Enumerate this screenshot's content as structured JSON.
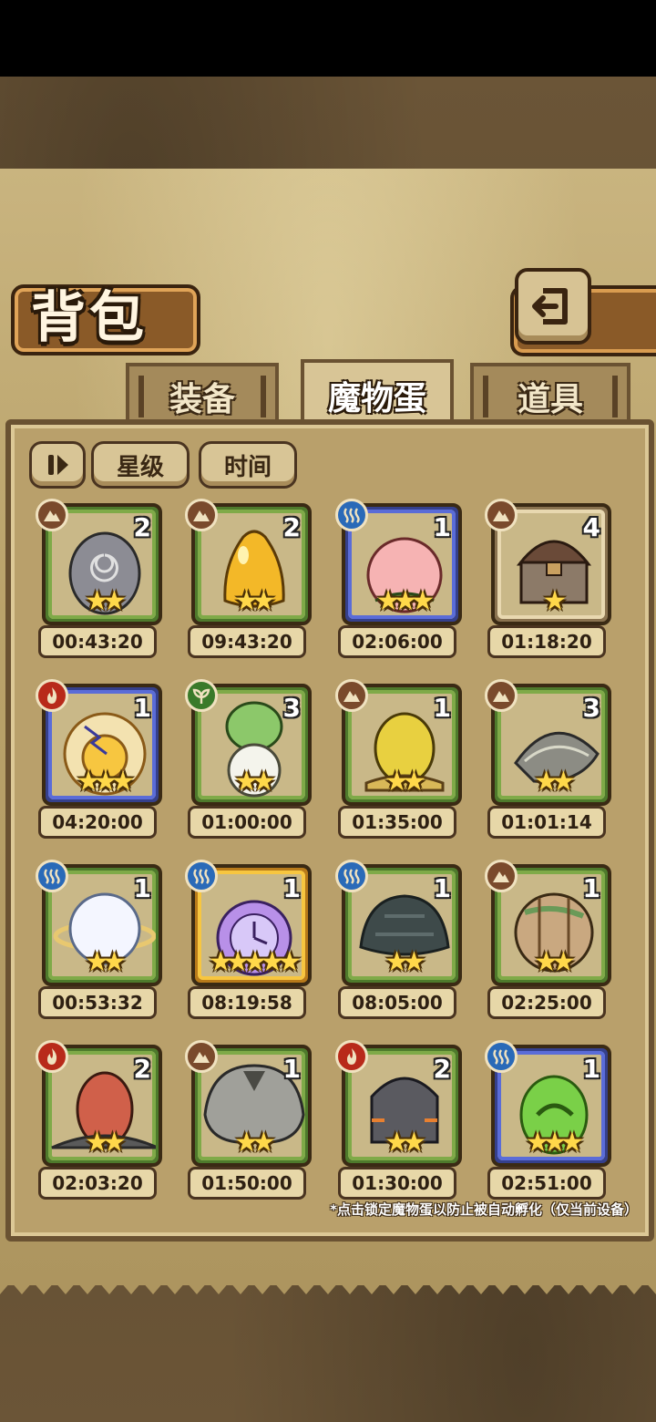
{
  "header": {
    "title": "背包"
  },
  "tabs": [
    {
      "label": "装备",
      "active": false
    },
    {
      "label": "魔物蛋",
      "active": true
    },
    {
      "label": "道具",
      "active": false
    }
  ],
  "toolbar": {
    "sort_star": "星级",
    "sort_time": "时间"
  },
  "eggs": [
    {
      "count": "2",
      "stars": "★★",
      "time": "00:43:20",
      "element": "earth",
      "rarity": "green"
    },
    {
      "count": "2",
      "stars": "★★",
      "time": "09:43:20",
      "element": "earth",
      "rarity": "green"
    },
    {
      "count": "1",
      "stars": "★★★",
      "time": "02:06:00",
      "element": "water",
      "rarity": "blue"
    },
    {
      "count": "4",
      "stars": "★",
      "time": "01:18:20",
      "element": "earth",
      "rarity": "beige"
    },
    {
      "count": "1",
      "stars": "★★★",
      "time": "04:20:00",
      "element": "fire",
      "rarity": "blue"
    },
    {
      "count": "3",
      "stars": "★★",
      "time": "01:00:00",
      "element": "plant",
      "rarity": "green"
    },
    {
      "count": "1",
      "stars": "★★",
      "time": "01:35:00",
      "element": "earth",
      "rarity": "green"
    },
    {
      "count": "3",
      "stars": "★★",
      "time": "01:01:14",
      "element": "earth",
      "rarity": "green"
    },
    {
      "count": "1",
      "stars": "★★",
      "time": "00:53:32",
      "element": "water",
      "rarity": "green"
    },
    {
      "count": "1",
      "stars": "★★★★★",
      "time": "08:19:58",
      "element": "water",
      "rarity": "gold"
    },
    {
      "count": "1",
      "stars": "★★",
      "time": "08:05:00",
      "element": "water",
      "rarity": "green"
    },
    {
      "count": "1",
      "stars": "★★",
      "time": "02:25:00",
      "element": "earth",
      "rarity": "green"
    },
    {
      "count": "2",
      "stars": "★★",
      "time": "02:03:20",
      "element": "fire",
      "rarity": "green"
    },
    {
      "count": "1",
      "stars": "★★",
      "time": "01:50:00",
      "element": "earth",
      "rarity": "green"
    },
    {
      "count": "2",
      "stars": "★★",
      "time": "01:30:00",
      "element": "fire",
      "rarity": "green"
    },
    {
      "count": "1",
      "stars": "★★★",
      "time": "02:51:00",
      "element": "water",
      "rarity": "blue"
    }
  ],
  "footnote": "*点击锁定魔物蛋以防止被自动孵化（仅当前设备）",
  "colors": {
    "panel": "#c9b47f",
    "frame_dark": "#3a2a14",
    "star": "#ffd84a"
  }
}
